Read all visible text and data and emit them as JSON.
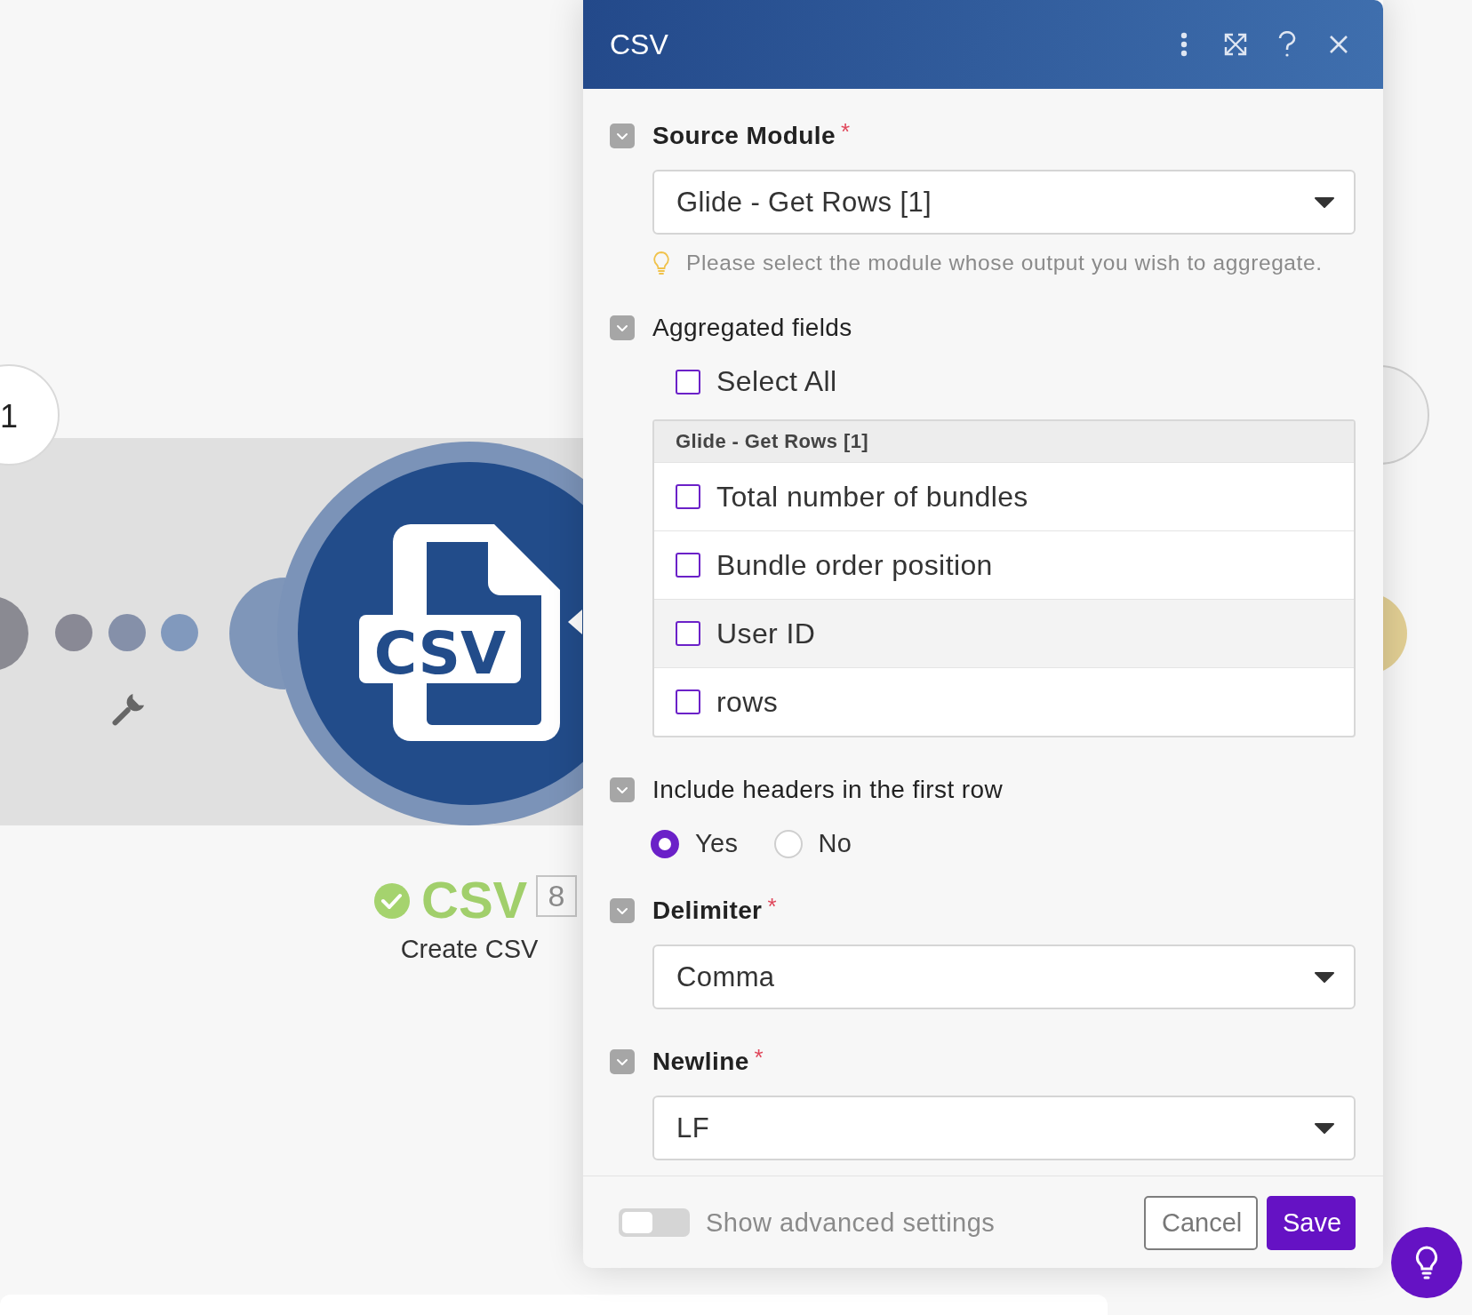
{
  "canvas": {
    "step_number": "1",
    "module": {
      "icon_label": "CSV",
      "succeeded": true,
      "name": "CSV",
      "badge": "8",
      "subtitle": "Create CSV"
    }
  },
  "panel": {
    "title": "CSV",
    "fields": [
      {
        "kind": "select",
        "label": "Source Module",
        "required": true,
        "required_mark": "*",
        "expanded": true,
        "value": "Glide - Get Rows [1]",
        "hint": "Please select the module whose output you wish to aggregate."
      },
      {
        "kind": "checklist",
        "label": "Aggregated fields",
        "required": false,
        "expanded": true,
        "select_all": {
          "label": "Select All",
          "checked": false
        },
        "group": "Glide - Get Rows [1]",
        "items": [
          {
            "label": "Total number of bundles",
            "checked": false,
            "hovered": false
          },
          {
            "label": "Bundle order position",
            "checked": false,
            "hovered": false
          },
          {
            "label": "User ID",
            "checked": false,
            "hovered": true
          },
          {
            "label": "rows",
            "checked": false,
            "hovered": false
          }
        ]
      },
      {
        "kind": "radio",
        "label": "Include headers in the first row",
        "required": false,
        "expanded": true,
        "options": [
          {
            "label": "Yes",
            "selected": true
          },
          {
            "label": "No",
            "selected": false
          }
        ]
      },
      {
        "kind": "select",
        "label": "Delimiter",
        "required": true,
        "required_mark": "*",
        "expanded": true,
        "value": "Comma"
      },
      {
        "kind": "select",
        "label": "Newline",
        "required": true,
        "required_mark": "*",
        "expanded": true,
        "value": "LF"
      }
    ],
    "footer": {
      "advanced_toggle": {
        "label": "Show advanced settings",
        "on": false
      },
      "buttons": [
        {
          "label": "Cancel",
          "kind": "secondary"
        },
        {
          "label": "Save",
          "kind": "primary"
        }
      ]
    }
  }
}
